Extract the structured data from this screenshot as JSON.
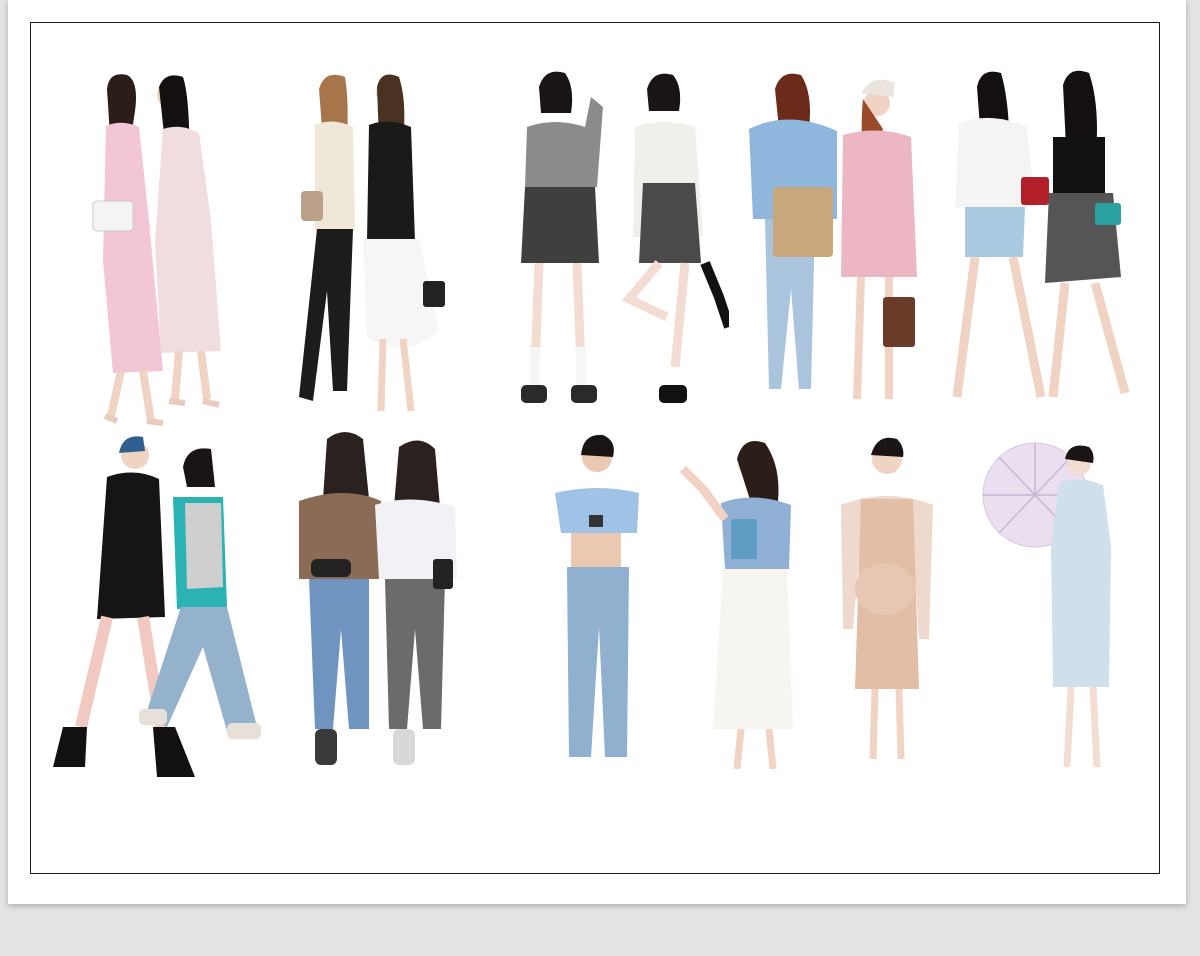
{
  "sheet": {
    "background": "#ffffff",
    "frame_border": "#1a1a1a"
  },
  "rows": [
    {
      "groups": [
        {
          "id": "pair-1",
          "figures": [
            {
              "id": "woman-pink-dress-white-bag",
              "icon": "person-figure-icon",
              "top": "#f2c6d4",
              "bottom": "#f2c6d4",
              "hair": "#2b1d18",
              "skin": "#f1d3c4",
              "accessory": "#f4f4f4"
            },
            {
              "id": "woman-floral-dress-long-hair",
              "icon": "person-figure-icon",
              "top": "#f1dde0",
              "bottom": "#f1dde0",
              "hair": "#141010",
              "skin": "#f1d3c4",
              "accessory": "#444444"
            }
          ]
        },
        {
          "id": "pair-2",
          "figures": [
            {
              "id": "woman-cream-cardigan-ripped-jeans",
              "icon": "person-figure-icon",
              "top": "#efe8d8",
              "bottom": "#1c1c1c",
              "hair": "#a8744a",
              "skin": "#f1d3c4",
              "accessory": "#bba18c"
            },
            {
              "id": "woman-black-blazer-white-ruffle-skirt",
              "icon": "person-figure-icon",
              "top": "#1a1a1a",
              "bottom": "#f6f6f6",
              "hair": "#4a3222",
              "skin": "#f1d3c4",
              "accessory": "#222222"
            }
          ]
        },
        {
          "id": "pair-3",
          "figures": [
            {
              "id": "girl-grey-cardigan-striped-skirt",
              "icon": "person-figure-icon",
              "top": "#8b8b8b",
              "bottom": "#3f3f3f",
              "hair": "#1a1414",
              "skin": "#f3ddd2",
              "accessory": "#2a2a2a"
            },
            {
              "id": "girl-white-sweater-grey-skirt",
              "icon": "person-figure-icon",
              "top": "#f1efea",
              "bottom": "#4a4a4a",
              "hair": "#1a1414",
              "skin": "#f3ddd2",
              "accessory": "#111111"
            }
          ]
        },
        {
          "id": "pair-4",
          "figures": [
            {
              "id": "woman-blue-fur-jacket-jeans-tote",
              "icon": "person-figure-icon",
              "top": "#8fb6dc",
              "bottom": "#a9c4dc",
              "hair": "#6b2a1a",
              "skin": "#f1d3c4",
              "accessory": "#c9a77c"
            },
            {
              "id": "woman-pink-coat-beanie",
              "icon": "person-figure-icon",
              "top": "#ecb7c3",
              "bottom": "#d8b7a0",
              "hair": "#9b4a2a",
              "skin": "#f1d3c4",
              "accessory": "#6b3b2a"
            }
          ]
        },
        {
          "id": "pair-5",
          "figures": [
            {
              "id": "woman-white-shirt-denim-shorts",
              "icon": "person-figure-icon",
              "top": "#f4f4f4",
              "bottom": "#a9c9e0",
              "hair": "#141010",
              "skin": "#f1d3c4",
              "accessory": "#b3202a"
            },
            {
              "id": "woman-black-top-gingham-skirt",
              "icon": "person-figure-icon",
              "top": "#111111",
              "bottom": "#555555",
              "hair": "#141010",
              "skin": "#f1d3c4",
              "accessory": "#2aa0a0"
            }
          ]
        }
      ]
    },
    {
      "groups": [
        {
          "id": "pair-6",
          "figures": [
            {
              "id": "woman-black-dress-blue-hair-boots",
              "icon": "person-figure-icon",
              "top": "#151515",
              "bottom": "#f1c9c0",
              "hair": "#2f5f8f",
              "skin": "#f1d3c4",
              "accessory": "#111111"
            },
            {
              "id": "woman-teal-leopard-top-jeans",
              "icon": "person-figure-icon",
              "top": "#2bb3b3",
              "bottom": "#94b2cc",
              "hair": "#1a1414",
              "skin": "#e8c6b2",
              "accessory": "#cfcfcf"
            }
          ]
        },
        {
          "id": "pair-7",
          "figures": [
            {
              "id": "woman-brown-top-blue-jeans-back",
              "icon": "person-figure-icon",
              "top": "#8a6b55",
              "bottom": "#6f94bf",
              "hair": "#2b2220",
              "skin": "#e8c6b2",
              "accessory": "#222222"
            },
            {
              "id": "woman-white-shirt-grey-jeans-back",
              "icon": "person-figure-icon",
              "top": "#f2f2f6",
              "bottom": "#6b6b6b",
              "hair": "#2b2220",
              "skin": "#e8c6b2",
              "accessory": "#222222"
            }
          ]
        },
        {
          "id": "single-1",
          "figures": [
            {
              "id": "woman-blue-crop-top-jeans-phone",
              "icon": "person-figure-icon",
              "top": "#9fc3e6",
              "bottom": "#8fb0cf",
              "hair": "#1a1414",
              "skin": "#eac8b2",
              "accessory": "#333333"
            }
          ]
        },
        {
          "id": "single-2",
          "figures": [
            {
              "id": "woman-blue-blouse-white-skirt-book",
              "icon": "person-figure-icon",
              "top": "#8fb0d4",
              "bottom": "#f7f5ef",
              "hair": "#2b1d18",
              "skin": "#f1d3c4",
              "accessory": "#5f9cc4"
            }
          ]
        },
        {
          "id": "single-3",
          "figures": [
            {
              "id": "pregnant-woman-beige-dress-cardigan",
              "icon": "person-figure-icon",
              "top": "#e7c7b3",
              "bottom": "#e2bea6",
              "hair": "#1a1414",
              "skin": "#f1d3c4",
              "accessory": "#efd8cc"
            }
          ]
        },
        {
          "id": "single-4",
          "figures": [
            {
              "id": "woman-qipao-paper-umbrella",
              "icon": "umbrella-figure-icon",
              "top": "#cfe0ea",
              "bottom": "#cfe0ea",
              "hair": "#1a1414",
              "skin": "#f3ddd2",
              "accessory": "#e9dfef"
            }
          ]
        }
      ]
    }
  ]
}
